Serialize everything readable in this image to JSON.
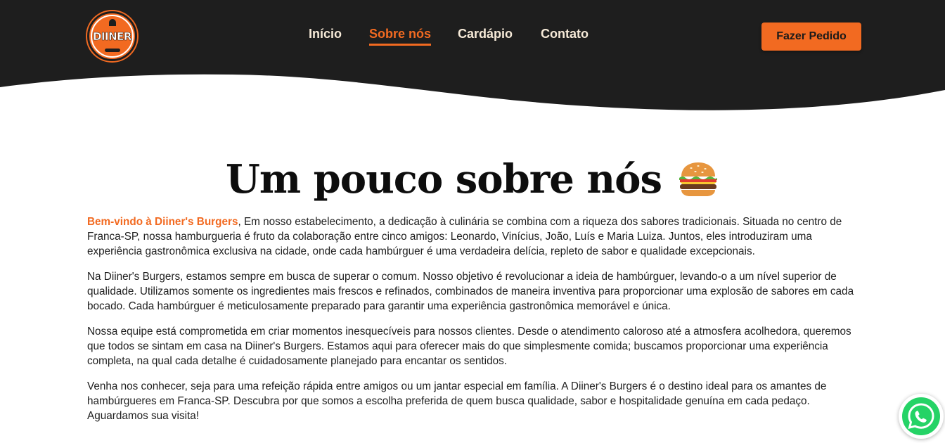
{
  "brand": {
    "logo_text": "DIINER",
    "accent_color": "#f26a21",
    "header_color": "#1e1e1e"
  },
  "nav": {
    "items": [
      {
        "label": "Início",
        "active": false
      },
      {
        "label": "Sobre nós",
        "active": true
      },
      {
        "label": "Cardápio",
        "active": false
      },
      {
        "label": "Contato",
        "active": false
      }
    ]
  },
  "header": {
    "cta_label": "Fazer Pedido"
  },
  "main": {
    "title": "Um pouco sobre nós",
    "title_icon": "burger-icon",
    "intro_highlight": "Bem-vindo à Diiner's Burgers",
    "intro_rest": ", Em nosso estabelecimento, a dedicação à culinária se combina com a riqueza dos sabores tradicionais. Situada no centro de Franca-SP, nossa hamburgueria é fruto da colaboração entre cinco amigos: Leonardo, Vinícius, João, Luís e Maria Luiza. Juntos, eles introduziram uma experiência gastronômica exclusiva na cidade, onde cada hambúrguer é uma verdadeira delícia, repleto de sabor e qualidade excepcionais.",
    "paragraph_2": "Na Diiner's Burgers, estamos sempre em busca de superar o comum. Nosso objetivo é revolucionar a ideia de hambúrguer, levando-o a um nível superior de qualidade. Utilizamos somente os ingredientes mais frescos e refinados, combinados de maneira inventiva para proporcionar uma explosão de sabores em cada bocado. Cada hambúrguer é meticulosamente preparado para garantir uma experiência gastronômica memorável e única.",
    "paragraph_3": "Nossa equipe está comprometida em criar momentos inesquecíveis para nossos clientes. Desde o atendimento caloroso até a atmosfera acolhedora, queremos que todos se sintam em casa na Diiner's Burgers. Estamos aqui para oferecer mais do que simplesmente comida; buscamos proporcionar uma experiência completa, na qual cada detalhe é cuidadosamente planejado para encantar os sentidos.",
    "paragraph_4": "Venha nos conhecer, seja para uma refeição rápida entre amigos ou um jantar especial em família. A Diiner's Burgers é o destino ideal para os amantes de hambúrgueres em Franca-SP. Descubra por que somos a escolha preferida de quem busca qualidade, sabor e hospitalidade genuína em cada pedaço. Aguardamos sua visita!"
  },
  "floating": {
    "whatsapp_icon": "whatsapp-icon",
    "whatsapp_color": "#25d366"
  }
}
